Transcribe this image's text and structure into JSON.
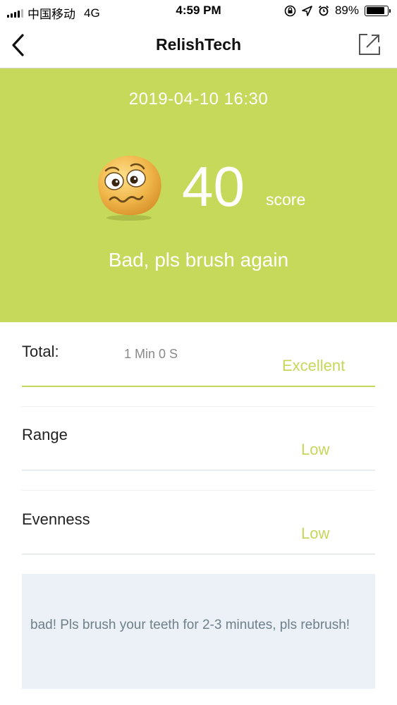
{
  "status_bar": {
    "carrier": "中国移动",
    "network": "4G",
    "time": "4:59 PM",
    "battery_percent": "89%",
    "battery_level": 0.89,
    "icons": [
      "signal-icon",
      "orientation-lock-icon",
      "location-icon",
      "alarm-icon",
      "battery-icon"
    ]
  },
  "nav": {
    "title": "RelishTech",
    "back_icon": "chevron-left-icon",
    "share_icon": "share-external-icon"
  },
  "result": {
    "datetime": "2019-04-10 16:30",
    "emoji": "worried-face-icon",
    "score": "40",
    "score_unit": "score",
    "message": "Bad, pls brush again"
  },
  "metrics": [
    {
      "label": "Total:",
      "value": "1 Min 0 S",
      "rating": "Excellent"
    },
    {
      "label": "Range",
      "value": "",
      "rating": "Low"
    },
    {
      "label": "Evenness",
      "value": "",
      "rating": "Low"
    }
  ],
  "advice": {
    "text": "bad! Pls brush your teeth for 2-3 minutes, pls rebrush!"
  },
  "colors": {
    "accent": "#c7d95b",
    "rating_text": "#c8d65a",
    "advice_bg": "#ebf1f6"
  }
}
